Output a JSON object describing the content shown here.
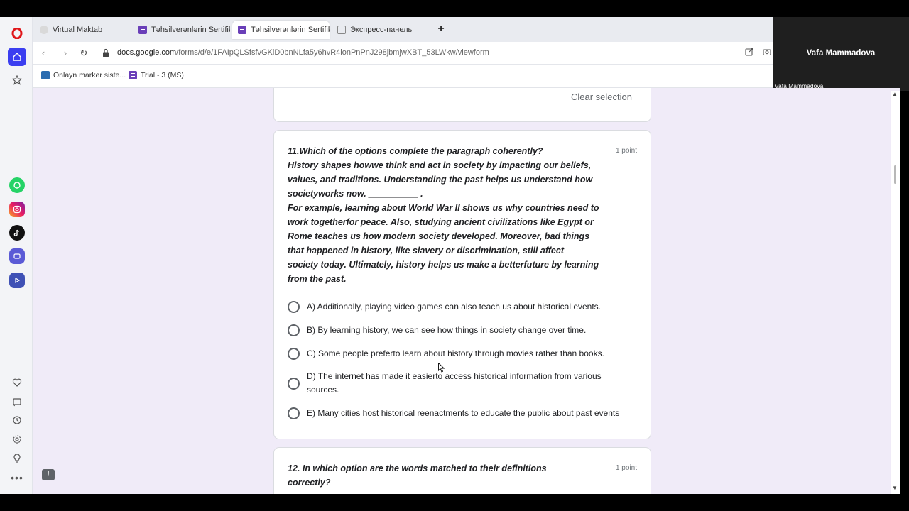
{
  "tabs": [
    {
      "label": "Virtual Maktab",
      "active": false
    },
    {
      "label": "Təhsilverənlərin Sertifikatl",
      "active": false
    },
    {
      "label": "Təhsilverənlərin Sertifikatl",
      "active": true
    },
    {
      "label": "Экспресс-панель",
      "active": false
    }
  ],
  "address": {
    "url_host": "docs.google.com",
    "url_path": "/forms/d/e/1FAIpQLSfsfvGKiD0bnNLfa5y6hvR4ionPnPnJ298jbmjwXBT_53LWkw/viewform"
  },
  "bookmarks": [
    {
      "label": "Onlayn marker siste..."
    },
    {
      "label": "Trial - 3 (MS)"
    }
  ],
  "video": {
    "participant_name": "Vafa Mammadova",
    "participant_label": "Vafa Mammadova"
  },
  "previous_question": {
    "clear_label": "Clear selection"
  },
  "question11": {
    "title": "11.Which of the options complete the paragraph coherently?",
    "body_lines": [
      "History shapes howwe think and act in society by impacting our beliefs,",
      "values, and traditions. Understanding the past helps us understand how",
      "societyworks now. __________ .",
      "For example, learning about World War II shows us why countries need to",
      "work togetherfor peace. Also, studying ancient civilizations like Egypt or",
      "Rome teaches us how modern society developed. Moreover, bad things",
      "that happened in history, like slavery or discrimination, still affect",
      "society today. Ultimately, history helps us make a betterfuture by learning",
      "from the past."
    ],
    "points": "1 point",
    "options": [
      "A) Additionally, playing video games can also teach us about historical events.",
      "B) By learning history, we can see how things in society change over time.",
      "C) Some people preferto learn about history through movies rather than books.",
      "D) The internet has made it easierto access historical information from various sources.",
      "E) Many cities host historical reenactments to educate the public about past events"
    ]
  },
  "question12": {
    "title_line1": "12. In which option are the words matched to their definitions",
    "title_line2": "correctly?",
    "points": "1 point"
  },
  "colors": {
    "page_bg": "#f0ebf8",
    "forms_purple": "#6a3fb8",
    "opera_red": "#e0161a",
    "workspace_blue": "#3b3ef0"
  },
  "icons": {
    "opera": "opera-logo-icon",
    "home": "home-icon",
    "star": "star-icon",
    "whatsapp": "whatsapp-icon",
    "instagram": "instagram-icon",
    "tiktok": "tiktok-icon",
    "music": "music-player-icon",
    "player": "player-icon",
    "heart": "heart-icon",
    "history": "clock-icon",
    "settings": "gear-icon",
    "tips": "lightbulb-icon",
    "more": "more-icon"
  }
}
